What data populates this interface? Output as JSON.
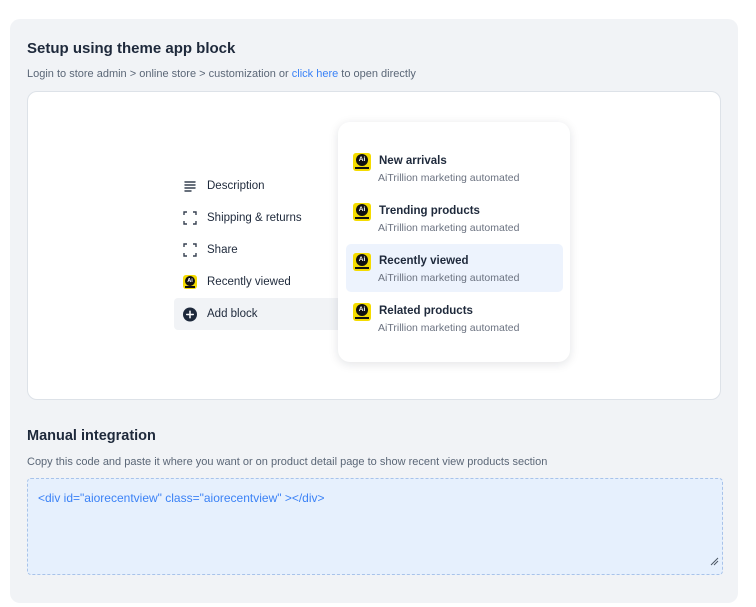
{
  "setup": {
    "title": "Setup using theme app block",
    "subtitle_prefix": "Login to store admin > online store > customization or ",
    "link_text": "click here",
    "subtitle_suffix": " to open directly"
  },
  "blocks": [
    {
      "icon": "text-lines-icon",
      "label": "Description"
    },
    {
      "icon": "dashed-frame-icon",
      "label": "Shipping & returns"
    },
    {
      "icon": "dashed-frame-icon",
      "label": "Share"
    },
    {
      "icon": "aitrillion-logo-icon",
      "label": "Recently viewed"
    },
    {
      "icon": "plus-circle-icon",
      "label": "Add block"
    }
  ],
  "dropdown": [
    {
      "name": "New arrivals",
      "desc": "AiTrillion marketing automated"
    },
    {
      "name": "Trending products",
      "desc": "AiTrillion marketing automated"
    },
    {
      "name": "Recently viewed",
      "desc": "AiTrillion marketing automated",
      "selected": true
    },
    {
      "name": "Related products",
      "desc": "AiTrillion marketing automated"
    }
  ],
  "logo_text": "Ai",
  "manual": {
    "title": "Manual integration",
    "desc": "Copy this code and paste it where you want or on product detail page to show recent view products section",
    "code": "<div id=\"aiorecentview\" class=\"aiorecentview\" ></div>"
  },
  "colors": {
    "accent": "#3b82f6",
    "logo_yellow": "#f5dc00",
    "code_bg": "#e6f0fd",
    "selected_bg": "#edf3fd"
  }
}
